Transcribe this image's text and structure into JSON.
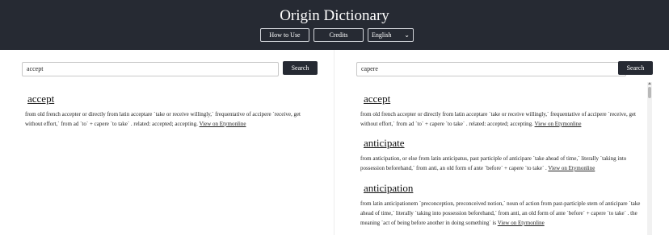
{
  "header": {
    "title": "Origin Dictionary",
    "how_to_use": "How to Use",
    "credits": "Credits",
    "language": "English"
  },
  "left": {
    "search_value": "accept",
    "search_button": "Search",
    "entries": [
      {
        "word": "accept",
        "definition": "from old french accepter or directly from latin acceptare `take or receive willingly,` frequentative of accipere `receive, get without effort,` from ad `to` + capere `to take` . related: accepted; accepting.",
        "link": "View on Etymonline"
      }
    ]
  },
  "right": {
    "search_value": "capere",
    "search_button": "Search",
    "entries": [
      {
        "word": "accept",
        "definition": "from old french accepter or directly from latin acceptare `take or receive willingly,` frequentative of accipere `receive, get without effort,` from ad `to` + capere `to take` . related: accepted; accepting.",
        "link": "View on Etymonline"
      },
      {
        "word": "anticipate",
        "definition": "from anticipation, or else from latin anticipatus, past participle of anticipare `take ahead of time,` literally `taking into possession beforehand,` from anti, an old form of ante `before` + capere `to take` .",
        "link": "View on Etymonline"
      },
      {
        "word": "anticipation",
        "definition": "from latin anticipationem `preconception, preconceived notion,` noun of action from past-participle stem of anticipare `take ahead of time,` literally `taking into possession beforehand,` from anti, an old form of ante `before` + capere `to take` . the meaning `act of being before another in doing something` is",
        "link": "View on Etymonline"
      }
    ]
  }
}
